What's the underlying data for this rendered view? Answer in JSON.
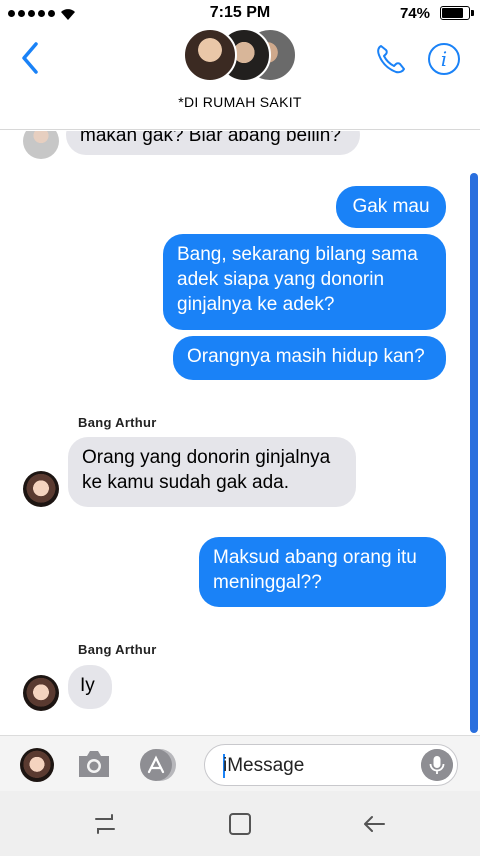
{
  "status_bar": {
    "time": "7:15 PM",
    "battery": "74%"
  },
  "header": {
    "contact_name": "*DI RUMAH SAKIT"
  },
  "messages": {
    "m0": "makan gak? Biar abang beliin?",
    "m1": "Gak mau",
    "m2_l1": "Bang, sekarang bilang sama",
    "m2_l2": "adek siapa yang donorin",
    "m2_l3": "ginjalnya ke adek?",
    "m3": "Orangnya masih hidup kan?",
    "sender1": "Bang Arthur",
    "m4_l1": "Orang yang donorin ginjalnya",
    "m4_l2": "ke kamu sudah gak ada.",
    "m5_l1": "Maksud abang orang itu",
    "m5_l2": "meninggal??",
    "sender2": "Bang Arthur",
    "m6": "Iy"
  },
  "input": {
    "placeholder": "iMessage"
  },
  "colors": {
    "accent": "#1a82f7",
    "bubble_in": "#e5e5ea",
    "scrollbar": "#2a6fde"
  },
  "icons": [
    "back-chevron-icon",
    "phone-icon",
    "info-icon",
    "camera-icon",
    "app-store-icon",
    "microphone-icon",
    "recent-apps-icon",
    "home-icon",
    "back-arrow-icon",
    "wifi-icon",
    "battery-icon",
    "signal-icon"
  ]
}
